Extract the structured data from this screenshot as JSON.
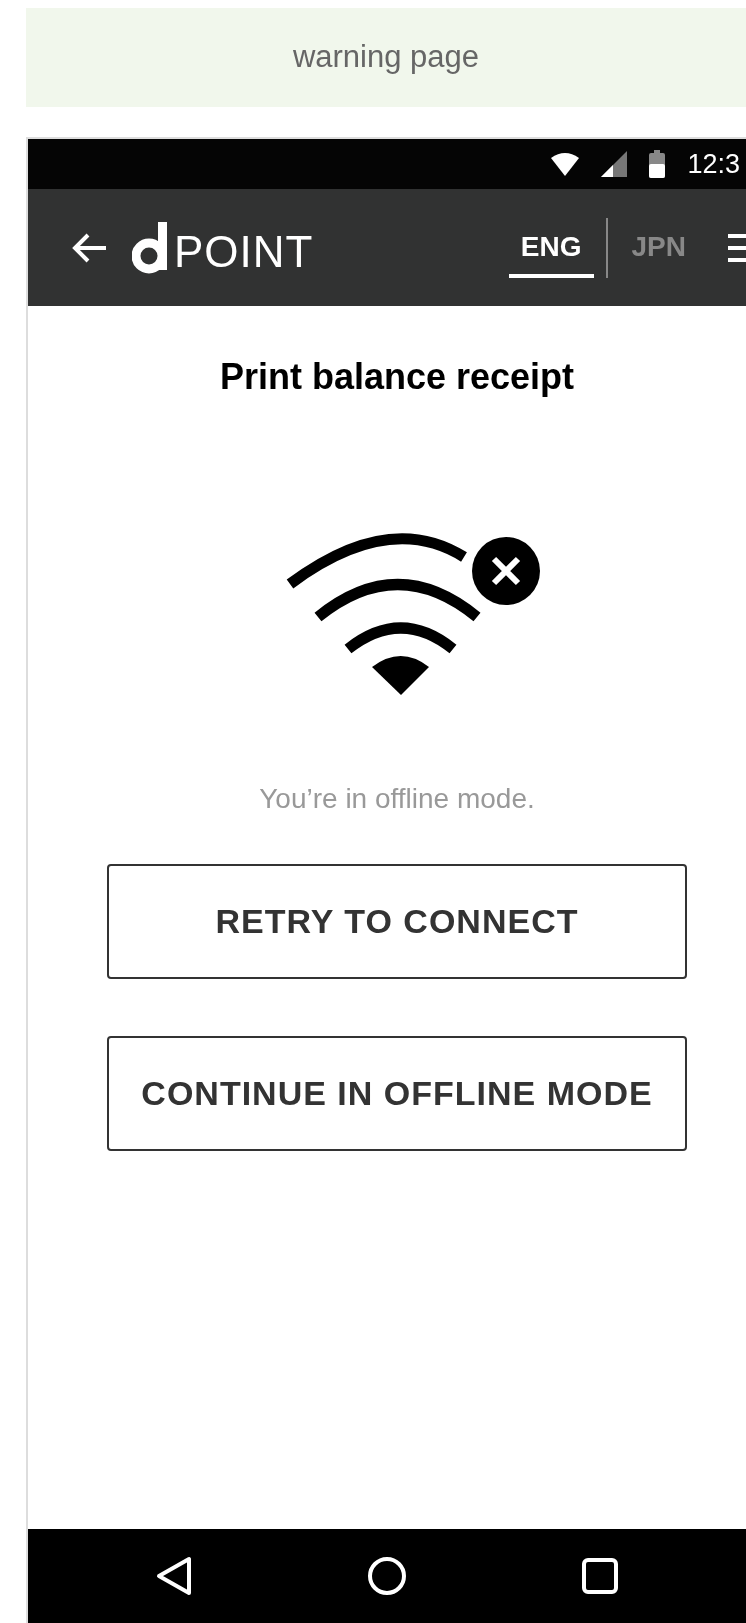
{
  "page_label": "warning page",
  "status_bar": {
    "time": "12:3"
  },
  "header": {
    "brand": "POINT",
    "languages": [
      {
        "label": "ENG",
        "selected": true
      },
      {
        "label": "JPN",
        "selected": false
      }
    ]
  },
  "title": "Print balance receipt",
  "message": "You’re in offline mode.",
  "buttons": [
    "RETRY TO CONNECT",
    "CONTINUE IN OFFLINE MODE"
  ]
}
